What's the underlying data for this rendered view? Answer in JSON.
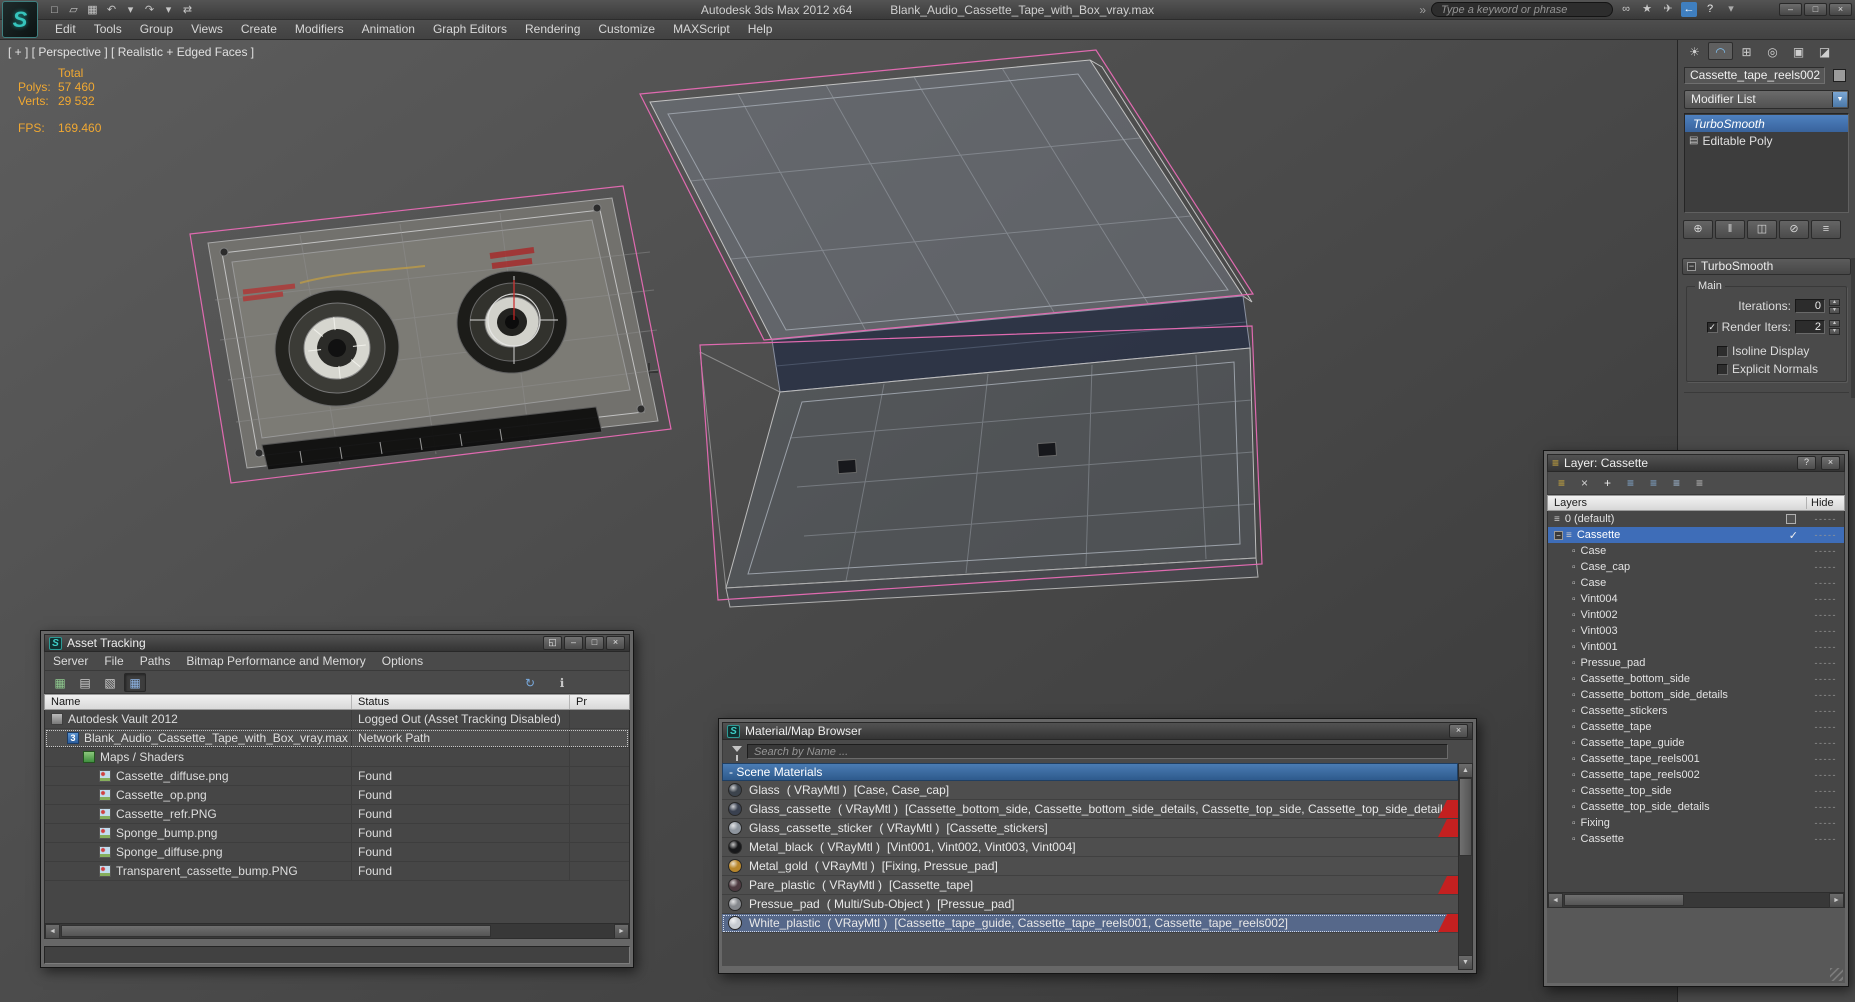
{
  "app": {
    "logo_glyph": "S"
  },
  "colors": {
    "selection_outline": "#e06ab0",
    "wireframe": "#b4b4b4",
    "stats_text": "#f0a832",
    "accent_blue": "#3e6db8",
    "section_header_blue": "#3a6ca5",
    "flag_red": "#c42020",
    "logo_teal": "#36c4bc"
  },
  "title_bar": {
    "app_title": "Autodesk 3ds Max 2012 x64",
    "doc_title": "Blank_Audio_Cassette_Tape_with_Box_vray.max",
    "search_placeholder": "Type a keyword or phrase",
    "overflow_glyph": "»",
    "quick_icons": [
      {
        "name": "new-scene-icon",
        "glyph": "□"
      },
      {
        "name": "open-file-icon",
        "glyph": "▱"
      },
      {
        "name": "save-file-icon",
        "glyph": "▦"
      },
      {
        "name": "undo-icon",
        "glyph": "↶"
      },
      {
        "name": "undo-dropdown-icon",
        "glyph": "▾"
      },
      {
        "name": "redo-icon",
        "glyph": "↷"
      },
      {
        "name": "redo-dropdown-icon",
        "glyph": "▾"
      },
      {
        "name": "manage-links-icon",
        "glyph": "⇄"
      }
    ],
    "info_icons": [
      {
        "name": "binoculars-icon",
        "glyph": "∞",
        "color": "#c9c9c9"
      },
      {
        "name": "favorites-icon",
        "glyph": "★",
        "color": "#c9c9c9"
      },
      {
        "name": "communication-center-icon",
        "glyph": "✈",
        "color": "#c9c9c9"
      },
      {
        "name": "sign-in-icon",
        "glyph": "←",
        "color": "#ffffff",
        "bg": "#3f7fc0"
      },
      {
        "name": "help-icon",
        "glyph": "?",
        "color": "#eaeaea"
      },
      {
        "name": "help-dropdown-icon",
        "glyph": "▾",
        "color": "#aaaaaa"
      }
    ],
    "window_buttons": [
      {
        "name": "minimize-button",
        "glyph": "–"
      },
      {
        "name": "maximize-button",
        "glyph": "□"
      },
      {
        "name": "close-button",
        "glyph": "×"
      }
    ]
  },
  "menu_bar": {
    "items": [
      "Edit",
      "Tools",
      "Group",
      "Views",
      "Create",
      "Modifiers",
      "Animation",
      "Graph Editors",
      "Rendering",
      "Customize",
      "MAXScript",
      "Help"
    ]
  },
  "viewport": {
    "label": "[ + ] [ Perspective ] [ Realistic + Edged Faces ]",
    "stats": {
      "total_label": "Total",
      "polys_label": "Polys:",
      "polys_value": "57 460",
      "verts_label": "Verts:",
      "verts_value": "29 532",
      "fps_label": "FPS:",
      "fps_value": "169.460"
    }
  },
  "command_panel": {
    "tabs": [
      {
        "name": "create-tab-icon",
        "glyph": "☀"
      },
      {
        "name": "modify-tab-icon",
        "glyph": "◠",
        "active": true
      },
      {
        "name": "hierarchy-tab-icon",
        "glyph": "⊞"
      },
      {
        "name": "motion-tab-icon",
        "glyph": "◎"
      },
      {
        "name": "display-tab-icon",
        "glyph": "▣"
      },
      {
        "name": "utilities-tab-icon",
        "glyph": "◪"
      }
    ],
    "object_name": "Cassette_tape_reels002",
    "modifier_list_label": "Modifier List",
    "combo_arrow_glyph": "▼",
    "stack": [
      {
        "label": "TurboSmooth",
        "selected": true,
        "bulb": true
      },
      {
        "label": "Editable Poly",
        "icon_glyph": "▤"
      }
    ],
    "stack_buttons": [
      {
        "name": "pin-stack-button",
        "glyph": "⊕"
      },
      {
        "name": "show-end-result-button",
        "glyph": "‖"
      },
      {
        "name": "make-unique-button",
        "glyph": "◫"
      },
      {
        "name": "remove-modifier-button",
        "glyph": "⊘"
      },
      {
        "name": "configure-modifier-sets-button",
        "glyph": "≡"
      }
    ],
    "rollout": {
      "collapse_glyph": "−",
      "title": "TurboSmooth",
      "group_label": "Main",
      "iterations_label": "Iterations:",
      "iterations_value": "0",
      "render_iters_label": "Render Iters:",
      "render_iters_value": "2",
      "isoline_label": "Isoline Display",
      "explicit_label": "Explicit Normals",
      "spin_up_glyph": "▲",
      "spin_down_glyph": "▼"
    }
  },
  "layer_dialog": {
    "title": "Layer: Cassette",
    "title_icon_glyph": "≡",
    "help_glyph": "?",
    "close_glyph": "×",
    "toolbar": [
      {
        "name": "new-layer-button",
        "glyph": "≡",
        "color": "#d9b23c"
      },
      {
        "name": "delete-layer-button",
        "glyph": "×",
        "color": "#d0d0d0"
      },
      {
        "name": "add-selection-to-layer-button",
        "glyph": "+",
        "color": "#eaeaea"
      },
      {
        "name": "select-layer-objects-button",
        "glyph": "≡",
        "color": "#86aed6"
      },
      {
        "name": "set-current-layer-button",
        "glyph": "≡",
        "color": "#86aed6"
      },
      {
        "name": "highlight-selected-layer-button",
        "glyph": "≡",
        "color": "#a8c4e0"
      },
      {
        "name": "hide-freeze-layer-button",
        "glyph": "≡",
        "color": "#c2c2c2"
      }
    ],
    "columns": {
      "layers": "Layers",
      "hide": "Hide"
    },
    "expander_glyph": "−",
    "check_glyph": "✓",
    "rows": [
      {
        "label": "0 (default)",
        "icon": "default-layer-icon",
        "glyph": "≡",
        "level": 0,
        "box": true,
        "dashes": "-----"
      },
      {
        "label": "Cassette",
        "icon": "layer-icon",
        "glyph": "≡",
        "level": 0,
        "selected": true,
        "expander": true,
        "check": true,
        "dashes": "-----"
      },
      {
        "label": "Case",
        "icon": "object-icon",
        "glyph": "▫",
        "level": 1,
        "dashes": "-----"
      },
      {
        "label": "Case_cap",
        "icon": "object-icon",
        "glyph": "▫",
        "level": 1,
        "dashes": "-----"
      },
      {
        "label": "Case",
        "icon": "object-icon",
        "glyph": "▫",
        "level": 1,
        "dashes": "-----"
      },
      {
        "label": "Vint004",
        "icon": "object-icon",
        "glyph": "▫",
        "level": 1,
        "dashes": "-----"
      },
      {
        "label": "Vint002",
        "icon": "object-icon",
        "glyph": "▫",
        "level": 1,
        "dashes": "-----"
      },
      {
        "label": "Vint003",
        "icon": "object-icon",
        "glyph": "▫",
        "level": 1,
        "dashes": "-----"
      },
      {
        "label": "Vint001",
        "icon": "object-icon",
        "glyph": "▫",
        "level": 1,
        "dashes": "-----"
      },
      {
        "label": "Pressue_pad",
        "icon": "object-icon",
        "glyph": "▫",
        "level": 1,
        "dashes": "-----"
      },
      {
        "label": "Cassette_bottom_side",
        "icon": "object-icon",
        "glyph": "▫",
        "level": 1,
        "dashes": "-----"
      },
      {
        "label": "Cassette_bottom_side_details",
        "icon": "object-icon",
        "glyph": "▫",
        "level": 1,
        "dashes": "-----"
      },
      {
        "label": "Cassette_stickers",
        "icon": "object-icon",
        "glyph": "▫",
        "level": 1,
        "dashes": "-----"
      },
      {
        "label": "Cassette_tape",
        "icon": "object-icon",
        "glyph": "▫",
        "level": 1,
        "dashes": "-----"
      },
      {
        "label": "Cassette_tape_guide",
        "icon": "object-icon",
        "glyph": "▫",
        "level": 1,
        "dashes": "-----"
      },
      {
        "label": "Cassette_tape_reels001",
        "icon": "object-icon",
        "glyph": "▫",
        "level": 1,
        "dashes": "-----"
      },
      {
        "label": "Cassette_tape_reels002",
        "icon": "object-icon",
        "glyph": "▫",
        "level": 1,
        "dashes": "-----"
      },
      {
        "label": "Cassette_top_side",
        "icon": "object-icon",
        "glyph": "▫",
        "level": 1,
        "dashes": "-----"
      },
      {
        "label": "Cassette_top_side_details",
        "icon": "object-icon",
        "glyph": "▫",
        "level": 1,
        "dashes": "-----"
      },
      {
        "label": "Fixing",
        "icon": "object-icon",
        "glyph": "▫",
        "level": 1,
        "dashes": "-----"
      },
      {
        "label": "Cassette",
        "icon": "object-icon",
        "glyph": "▫",
        "level": 1,
        "dashes": "-----"
      }
    ],
    "scroll": {
      "left_glyph": "◄",
      "right_glyph": "►"
    }
  },
  "asset_tracking": {
    "title": "Asset Tracking",
    "window_buttons": [
      {
        "name": "rollup-button",
        "glyph": "◱",
        "wide": true
      },
      {
        "name": "minimize-button",
        "glyph": "–"
      },
      {
        "name": "maximize-button",
        "glyph": "□"
      },
      {
        "name": "close-button",
        "glyph": "×"
      }
    ],
    "menu": [
      "Server",
      "File",
      "Paths",
      "Bitmap Performance and Memory",
      "Options"
    ],
    "toolbar": [
      {
        "name": "vault-explorer-icon",
        "glyph": "▦",
        "color": "#8fca8f"
      },
      {
        "name": "list-view-icon",
        "glyph": "▤",
        "color": "#cfcfcf"
      },
      {
        "name": "edit-paths-icon",
        "glyph": "▧",
        "color": "#cfcfcf"
      },
      {
        "name": "table-view-icon",
        "glyph": "▦",
        "color": "#8fb7e8",
        "pressed": true
      }
    ],
    "toolbar_right": [
      {
        "name": "sync-status-icon",
        "glyph": "↻",
        "color": "#79aade"
      },
      {
        "name": "info-icon",
        "glyph": "ℹ",
        "color": "#c9c9c9"
      }
    ],
    "columns": [
      "Name",
      "Status",
      "Pr"
    ],
    "rows": [
      {
        "name": "Autodesk Vault 2012",
        "status": "Logged Out (Asset Tracking Disabled)",
        "icon": "vault-icon",
        "level": 0
      },
      {
        "name": "Blank_Audio_Cassette_Tape_with_Box_vray.max",
        "status": "Network Path",
        "icon": "max-file-icon",
        "badge": "3",
        "level": 1,
        "focused": true
      },
      {
        "name": "Maps / Shaders",
        "status": "",
        "icon": "maps-icon",
        "level": 2
      },
      {
        "name": "Cassette_diffuse.png",
        "status": "Found",
        "icon": "image-icon",
        "level": 3
      },
      {
        "name": "Cassette_op.png",
        "status": "Found",
        "icon": "image-icon",
        "level": 3
      },
      {
        "name": "Cassette_refr.PNG",
        "status": "Found",
        "icon": "image-icon",
        "level": 3
      },
      {
        "name": "Sponge_bump.png",
        "status": "Found",
        "icon": "image-icon",
        "level": 3
      },
      {
        "name": "Sponge_diffuse.png",
        "status": "Found",
        "icon": "image-icon",
        "level": 3
      },
      {
        "name": "Transparent_cassette_bump.PNG",
        "status": "Found",
        "icon": "image-icon",
        "level": 3
      }
    ],
    "scroll": {
      "left_glyph": "◄",
      "right_glyph": "►"
    }
  },
  "material_browser": {
    "title": "Material/Map Browser",
    "close_glyph": "×",
    "search_placeholder": "Search by Name ...",
    "section_label": "- Scene Materials",
    "rows": [
      {
        "name": "Glass",
        "type": "( VRayMtl )",
        "objects": "[Case, Case_cap]",
        "ball": "#3c434c"
      },
      {
        "name": "Glass_cassette",
        "type": "( VRayMtl )",
        "objects": "[Cassette_bottom_side, Cassette_bottom_side_details, Cassette_top_side, Cassette_top_side_details]",
        "ball": "#3a4150",
        "flag": true
      },
      {
        "name": "Glass_cassette_sticker",
        "type": "( VRayMtl )",
        "objects": "[Cassette_stickers]",
        "ball": "#8e959e",
        "flag": true
      },
      {
        "name": "Metal_black",
        "type": "( VRayMtl )",
        "objects": "[Vint001, Vint002, Vint003, Vint004]",
        "ball": "#17181a"
      },
      {
        "name": "Metal_gold",
        "type": "( VRayMtl )",
        "objects": "[Fixing, Pressue_pad]",
        "ball": "#b8862b"
      },
      {
        "name": "Pare_plastic",
        "type": "( VRayMtl )",
        "objects": "[Cassette_tape]",
        "ball": "#4e3a41",
        "flag": true
      },
      {
        "name": "Pressue_pad",
        "type": "( Multi/Sub-Object )",
        "objects": "[Pressue_pad]",
        "ball": "#85888d"
      },
      {
        "name": "White_plastic",
        "type": "( VRayMtl )",
        "objects": "[Cassette_tape_guide, Cassette_tape_reels001, Cassette_tape_reels002]",
        "ball": "#c6cbd1",
        "flag": true,
        "selected": true
      }
    ],
    "scroll": {
      "up_glyph": "▲",
      "down_glyph": "▼"
    }
  }
}
